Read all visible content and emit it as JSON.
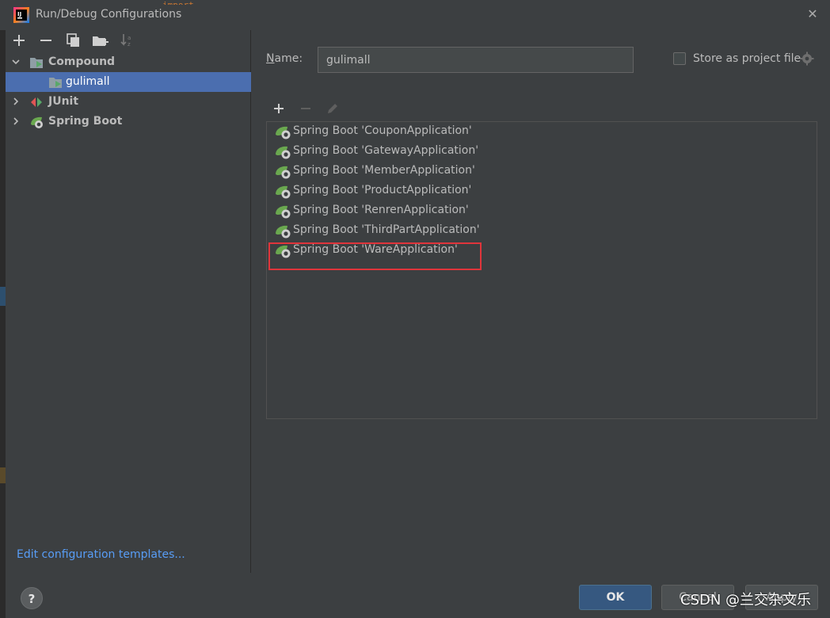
{
  "window": {
    "title": "Run/Debug Configurations",
    "close_glyph": "✕",
    "code_peek": "import ..."
  },
  "toolbar": {
    "items": [
      "add-icon",
      "remove-icon",
      "copy-icon",
      "folder-icon",
      "sort-icon"
    ]
  },
  "tree": {
    "items": [
      {
        "label": "Compound",
        "expanded": true,
        "icon": "compound-icon"
      },
      {
        "label": "gulimall",
        "selected": true,
        "icon": "compound-run-icon"
      },
      {
        "label": "JUnit",
        "expanded": false,
        "icon": "junit-icon"
      },
      {
        "label": "Spring Boot",
        "expanded": false,
        "icon": "spring-boot-icon"
      }
    ]
  },
  "edit_templates_link": "Edit configuration templates...",
  "name_field": {
    "label_u": "N",
    "label_rest": "ame:",
    "value": "gulimall"
  },
  "store_option": {
    "label": "Store as project file",
    "checked": false
  },
  "list_toolbar": {
    "items": [
      "add-icon",
      "remove-icon",
      "edit-icon"
    ]
  },
  "run_configs": [
    "Spring Boot 'CouponApplication'",
    "Spring Boot 'GatewayApplication'",
    "Spring Boot 'MemberApplication'",
    "Spring Boot 'ProductApplication'",
    "Spring Boot 'RenrenApplication'",
    "Spring Boot 'ThirdPartApplication'",
    "Spring Boot 'WareApplication'"
  ],
  "buttons": {
    "help": "?",
    "ok": "OK",
    "cancel": "Cancel",
    "apply": "Apply"
  },
  "watermark": "CSDN @兰交杂文乐",
  "colors": {
    "background": "#3c3f41",
    "selection": "#4b6eaf",
    "link": "#589df6",
    "ok_button": "#365880",
    "highlight": "#e0353b",
    "spring_green": "#6aa84f"
  }
}
